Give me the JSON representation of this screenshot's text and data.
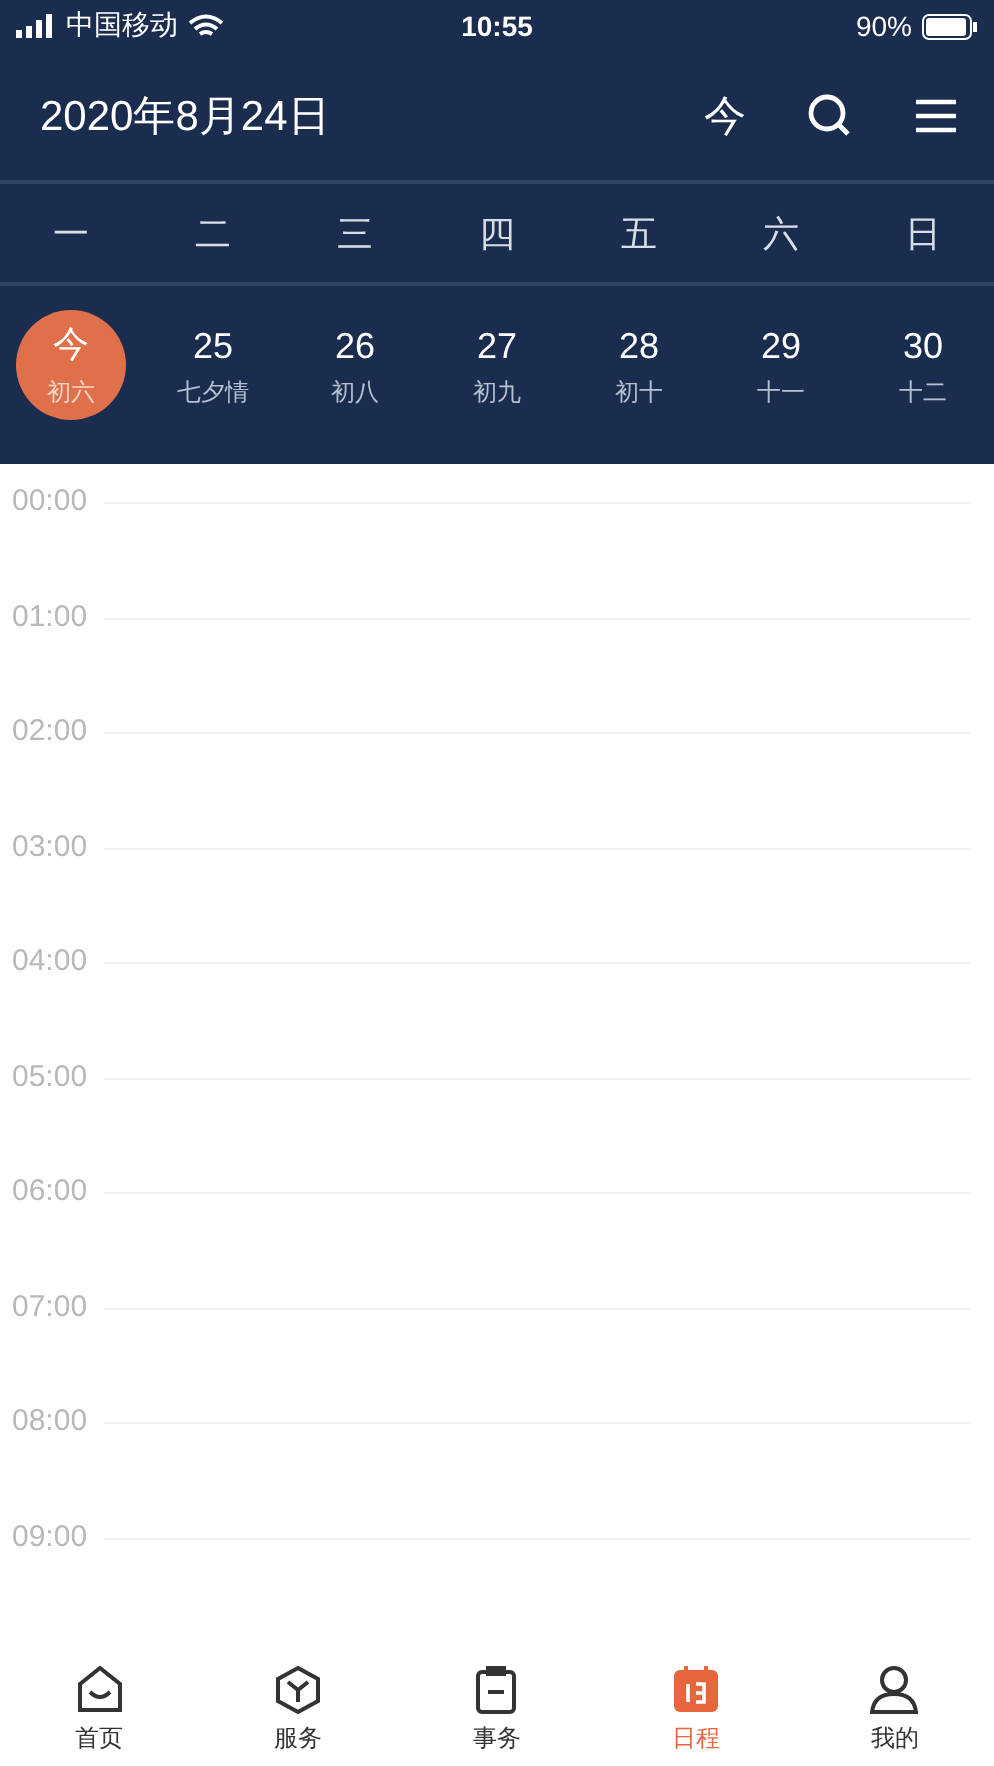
{
  "status_bar": {
    "carrier": "中国移动",
    "time": "10:55",
    "battery": "90%"
  },
  "header": {
    "title": "2020年8月24日",
    "today_button": "今"
  },
  "weekdays": [
    "一",
    "二",
    "三",
    "四",
    "五",
    "六",
    "日"
  ],
  "days": [
    {
      "day": "今",
      "lunar": "初六",
      "selected": true
    },
    {
      "day": "25",
      "lunar": "七夕情",
      "selected": false
    },
    {
      "day": "26",
      "lunar": "初八",
      "selected": false
    },
    {
      "day": "27",
      "lunar": "初九",
      "selected": false
    },
    {
      "day": "28",
      "lunar": "初十",
      "selected": false
    },
    {
      "day": "29",
      "lunar": "十一",
      "selected": false
    },
    {
      "day": "30",
      "lunar": "十二",
      "selected": false
    }
  ],
  "hours": [
    "00:00",
    "01:00",
    "02:00",
    "03:00",
    "04:00",
    "05:00",
    "06:00",
    "07:00",
    "08:00",
    "09:00"
  ],
  "tab_bar": [
    {
      "label": "首页",
      "kind": "home",
      "selected": false
    },
    {
      "label": "服务",
      "kind": "service",
      "selected": false
    },
    {
      "label": "事务",
      "kind": "task",
      "selected": false
    },
    {
      "label": "日程",
      "kind": "calendar",
      "selected": true
    },
    {
      "label": "我的",
      "kind": "profile",
      "selected": false
    }
  ]
}
